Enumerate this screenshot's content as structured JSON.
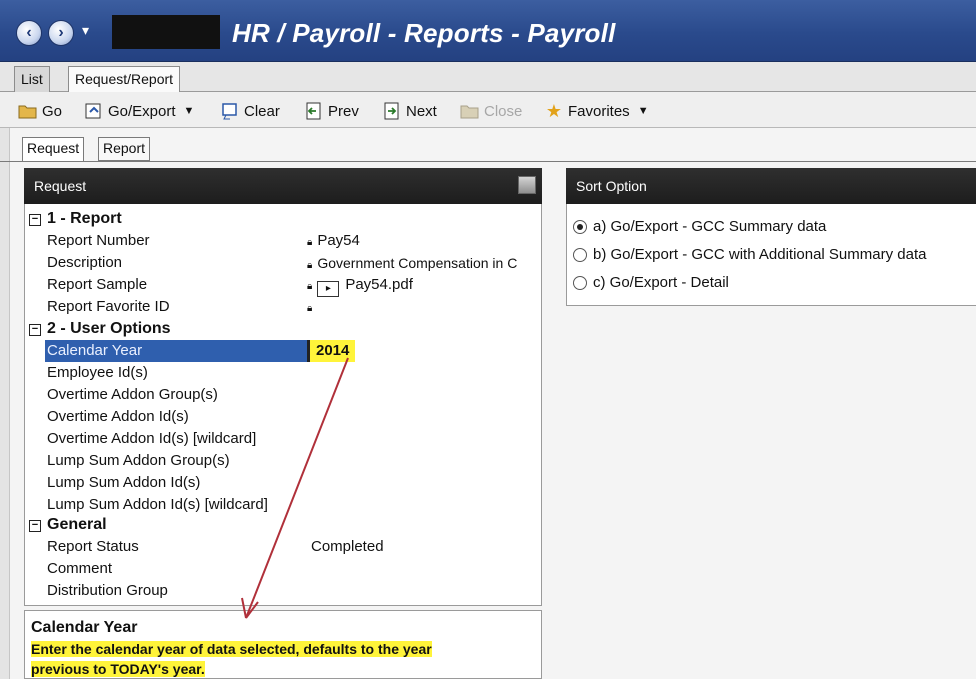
{
  "title": "HR / Payroll - Reports - Payroll",
  "nav": {
    "back_icon": "back-arrow-icon",
    "forward_icon": "forward-arrow-icon",
    "menu_caret": "▾"
  },
  "top_tabs": [
    {
      "label": "List"
    },
    {
      "label": "Request/Report"
    }
  ],
  "toolbar": {
    "go": "Go",
    "go_export": "Go/Export",
    "clear": "Clear",
    "prev": "Prev",
    "next": "Next",
    "close": "Close",
    "favorites": "Favorites"
  },
  "sub_tabs": [
    {
      "label": "Request"
    },
    {
      "label": "Report"
    }
  ],
  "request_panel": {
    "title": "Request",
    "groups": [
      {
        "label": "1 - Report"
      },
      {
        "label": "2 - User Options"
      },
      {
        "label": "General"
      }
    ],
    "rows": [
      {
        "label": "Report Number",
        "value": "Pay54"
      },
      {
        "label": "Description",
        "value": "Government Compensation in C"
      },
      {
        "label": "Report Sample",
        "value": "Pay54.pdf"
      },
      {
        "label": "Report Favorite ID",
        "value": ""
      },
      {
        "label": "Calendar Year",
        "value": "2014"
      },
      {
        "label": "Employee Id(s)",
        "value": ""
      },
      {
        "label": "Overtime Addon Group(s)",
        "value": ""
      },
      {
        "label": "Overtime Addon Id(s)",
        "value": ""
      },
      {
        "label": "Overtime Addon Id(s) [wildcard]",
        "value": ""
      },
      {
        "label": "Lump Sum Addon Group(s)",
        "value": ""
      },
      {
        "label": "Lump Sum Addon Id(s)",
        "value": ""
      },
      {
        "label": "Lump Sum Addon Id(s) [wildcard]",
        "value": ""
      },
      {
        "label": "Report Status",
        "value": "Completed"
      },
      {
        "label": "Comment",
        "value": ""
      },
      {
        "label": "Distribution Group",
        "value": ""
      }
    ]
  },
  "help": {
    "title": "Calendar Year",
    "text_line1": "Enter the calendar year of data selected, defaults to the year",
    "text_line2": "previous to TODAY's year."
  },
  "sort_panel": {
    "title": "Sort Option",
    "options": [
      {
        "label": "a) Go/Export - GCC Summary data",
        "selected": true
      },
      {
        "label": "b) Go/Export - GCC with Additional Summary data",
        "selected": false
      },
      {
        "label": "c) Go/Export - Detail",
        "selected": false
      }
    ]
  },
  "colors": {
    "title_bar": "#2a4a8c",
    "highlight": "#fff43a",
    "selection": "#2f5fae",
    "arrow": "#b0303a"
  }
}
